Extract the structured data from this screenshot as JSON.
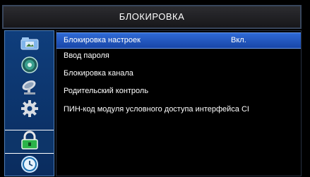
{
  "title": "БЛОКИРОВКА",
  "side_tabs": [
    {
      "icon": "picture-folder-icon",
      "label": ""
    },
    {
      "icon": "speaker-icon",
      "label": ""
    },
    {
      "icon": "satellite-dish-icon",
      "label": ""
    },
    {
      "icon": "gear-icon",
      "label": ""
    },
    {
      "icon": "lock-icon",
      "label": "",
      "active": true
    },
    {
      "icon": "clock-icon",
      "label": ""
    }
  ],
  "menu": [
    {
      "label": "Блокировка настроек",
      "value": "Вкл.",
      "selected": true
    },
    {
      "label": "Ввод пароля",
      "value": ""
    },
    {
      "label": "Блокировка канала",
      "value": ""
    },
    {
      "label": "Родительский контроль",
      "value": ""
    },
    {
      "label": "ПИН-код модуля условного доступа интерфейса CI",
      "value": ""
    }
  ],
  "colors": {
    "sidebar": "#0f3e7c",
    "selection": "#2f6ad6",
    "lock_body": "#2bb34a"
  }
}
